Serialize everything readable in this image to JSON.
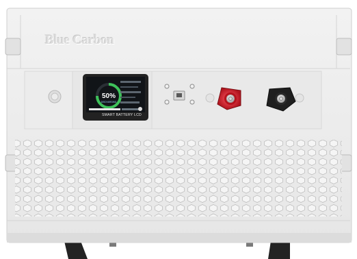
{
  "product": {
    "brand_text": "Blue Carbon",
    "lcd_caption": "SMART BATTERY LCD",
    "lcd_state_of_charge": "50%",
    "lcd_status_text": "DISCHARGING"
  },
  "colors": {
    "housing": "#ececec",
    "panel": "#e4e4e4",
    "lcd_bezel": "#222222",
    "gauge_green": "#3ec25a",
    "positive_terminal": "#c8202a",
    "negative_terminal": "#1f1f1f"
  },
  "icons": [
    "power-button-icon",
    "ethernet-port-icon",
    "mounting-screw-icon"
  ]
}
